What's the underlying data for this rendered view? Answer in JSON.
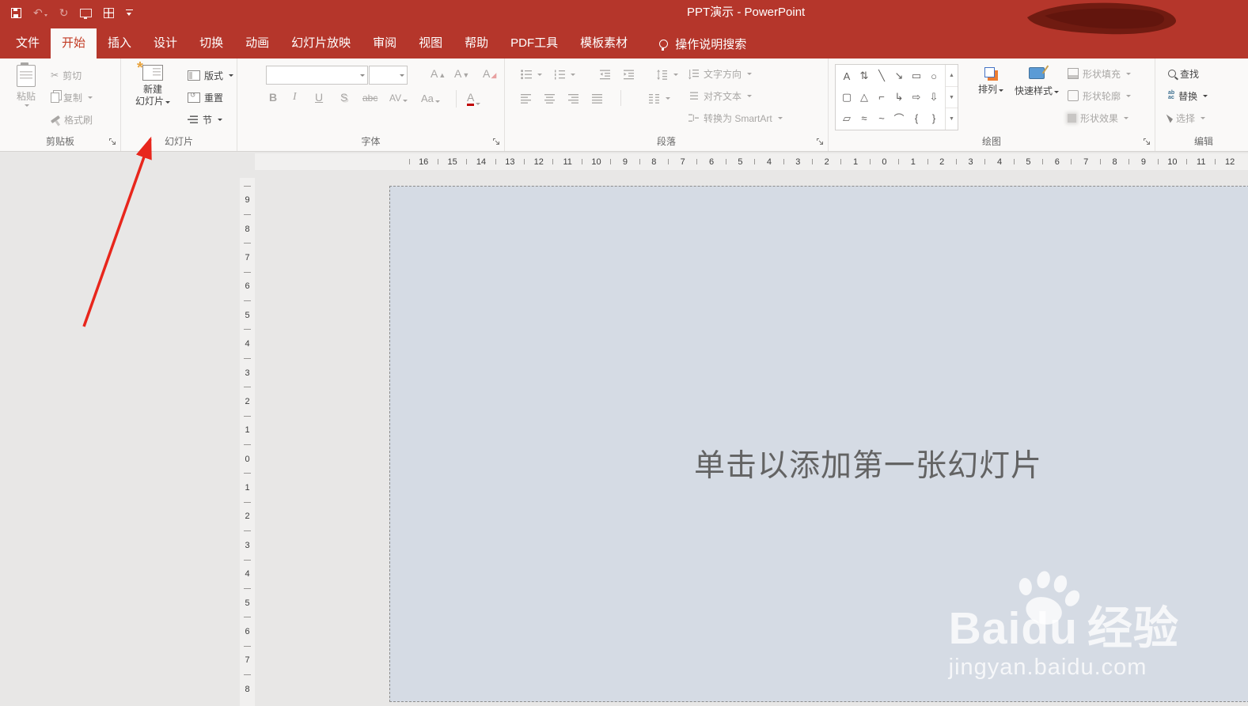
{
  "titlebar": {
    "title": "PPT演示  -  PowerPoint"
  },
  "icons": {
    "undo": "↶",
    "redo": "↻",
    "cut": "✂",
    "gallery_up": "▲",
    "gallery_down": "▼",
    "gallery_more": "▼"
  },
  "tabs": [
    {
      "label": "文件",
      "active": false
    },
    {
      "label": "开始",
      "active": true
    },
    {
      "label": "插入",
      "active": false
    },
    {
      "label": "设计",
      "active": false
    },
    {
      "label": "切换",
      "active": false
    },
    {
      "label": "动画",
      "active": false
    },
    {
      "label": "幻灯片放映",
      "active": false
    },
    {
      "label": "审阅",
      "active": false
    },
    {
      "label": "视图",
      "active": false
    },
    {
      "label": "帮助",
      "active": false
    },
    {
      "label": "PDF工具",
      "active": false
    },
    {
      "label": "模板素材",
      "active": false
    }
  ],
  "tell_me": {
    "label": "操作说明搜索"
  },
  "ribbon": {
    "clipboard": {
      "label": "剪贴板",
      "paste": "粘贴",
      "cut": "剪切",
      "copy": "复制",
      "format_painter": "格式刷"
    },
    "slides": {
      "label": "幻灯片",
      "new_slide_line1": "新建",
      "new_slide_line2": "幻灯片",
      "layout": "版式",
      "reset": "重置",
      "section": "节"
    },
    "font": {
      "label": "字体",
      "bold": "B",
      "italic": "I",
      "underline": "U",
      "shadow": "S",
      "strikethrough": "abc",
      "char_spacing": "AV",
      "change_case": "Aa",
      "font_color": "A"
    },
    "paragraph": {
      "label": "段落",
      "text_direction": "文字方向",
      "align_text": "对齐文本",
      "smartart": "转换为 SmartArt"
    },
    "drawing": {
      "label": "绘图",
      "arrange": "排列",
      "quick_styles": "快速样式",
      "shape_fill": "形状填充",
      "shape_outline": "形状轮廓",
      "shape_effects": "形状效果",
      "shapes_row1": [
        {
          "n": "text-box",
          "g": "A"
        },
        {
          "n": "vertical-text-box",
          "g": "⇅"
        },
        {
          "n": "line",
          "g": "╲"
        },
        {
          "n": "arrow-line",
          "g": "↘"
        },
        {
          "n": "rectangle",
          "g": "▭"
        },
        {
          "n": "oval",
          "g": "○"
        }
      ],
      "shapes_row2": [
        {
          "n": "rounded-rectangle",
          "g": "▢"
        },
        {
          "n": "triangle",
          "g": "△"
        },
        {
          "n": "elbow-connector",
          "g": "⌐"
        },
        {
          "n": "elbow-arrow-connector",
          "g": "↳"
        },
        {
          "n": "right-block-arrow",
          "g": "⇨"
        },
        {
          "n": "down-block-arrow",
          "g": "⇩"
        }
      ],
      "shapes_row3": [
        {
          "n": "freeform",
          "g": "▱"
        },
        {
          "n": "curve",
          "g": "≈"
        },
        {
          "n": "scribble",
          "g": "~"
        },
        {
          "n": "arc",
          "g": "⌒"
        },
        {
          "n": "left-brace",
          "g": "{"
        },
        {
          "n": "right-brace",
          "g": "}"
        }
      ]
    },
    "editing": {
      "label": "编辑",
      "find": "查找",
      "replace": "替换",
      "select": "选择"
    }
  },
  "rulers": {
    "horizontal": [
      16,
      15,
      14,
      13,
      12,
      11,
      10,
      9,
      8,
      7,
      6,
      5,
      4,
      3,
      2,
      1,
      0,
      1,
      2,
      3,
      4,
      5,
      6,
      7,
      8,
      9,
      10,
      11,
      12
    ],
    "vertical": [
      9,
      8,
      7,
      6,
      5,
      4,
      3,
      2,
      1,
      0,
      1,
      2,
      3,
      4,
      5,
      6,
      7,
      8
    ]
  },
  "canvas": {
    "placeholder": "单击以添加第一张幻灯片"
  },
  "watermark": {
    "brand_bai": "Bai",
    "brand_du": "du",
    "brand_cn": "经验",
    "url": "jingyan.baidu.com"
  },
  "colors": {
    "accent_red": "#B5362B",
    "annotation_red": "#E8261C",
    "canvas_bg": "#D5DBE4"
  }
}
